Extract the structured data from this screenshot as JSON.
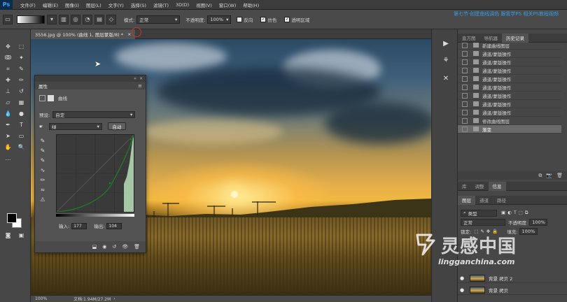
{
  "menubar": {
    "logo": "Ps",
    "items": [
      "文件(F)",
      "编辑(E)",
      "图像(I)",
      "图层(L)",
      "文字(Y)",
      "选择(S)",
      "滤镜(T)",
      "3D(D)",
      "视图(V)",
      "窗口(W)",
      "帮助(H)"
    ]
  },
  "options": {
    "mode_label": "模式:",
    "mode_value": "正常",
    "opacity_label": "不透明度:",
    "opacity_value": "100%",
    "reverse_label": "反向",
    "dither_label": "仿色",
    "transparency_label": "透明区域",
    "top_watermark": "第七节·创建曲线调色 跟我学PS 相关PS教程视频"
  },
  "document": {
    "tab_title": "3556.jpg @ 100% (曲线 1, 图层蒙版/8) *"
  },
  "status": {
    "zoom": "100%",
    "doc_info": "文档:1.94M/27.2M"
  },
  "properties": {
    "title": "属性",
    "curves_label": "曲线",
    "preset_label": "预设:",
    "preset_value": "自定",
    "channel_value": "绿",
    "auto_label": "自动",
    "input_label": "输入:",
    "input_value": "177",
    "output_label": "输出:",
    "output_value": "104"
  },
  "history": {
    "tabs": [
      "直方图",
      "导航器",
      "历史记录"
    ],
    "active_tab": "历史记录",
    "items": [
      "新建曲线图层",
      "通道/蒙版操作",
      "通道/蒙版操作",
      "通道/蒙版操作",
      "通道/蒙版操作",
      "通道/蒙版操作",
      "通道/蒙版操作",
      "通道/蒙版操作",
      "通道/蒙版操作",
      "修改曲线图层",
      "渐变"
    ],
    "selected_index": 10
  },
  "adjust_tabs": [
    "库",
    "调整",
    "信息"
  ],
  "layers": {
    "tabs": [
      "图层",
      "通道",
      "路径"
    ],
    "kind_label": "类型",
    "blend_value": "正常",
    "opacity_label": "不透明度:",
    "opacity_value": "100%",
    "lock_label": "锁定:",
    "fill_label": "填充:",
    "fill_value": "100%",
    "rows": [
      "背景 拷贝 2",
      "背景 拷贝"
    ]
  },
  "watermark": {
    "big": "灵感中国",
    "url": "lingganchina.com"
  },
  "colors": {
    "accent": "#31a8ff",
    "curve": "#2e7d32"
  }
}
